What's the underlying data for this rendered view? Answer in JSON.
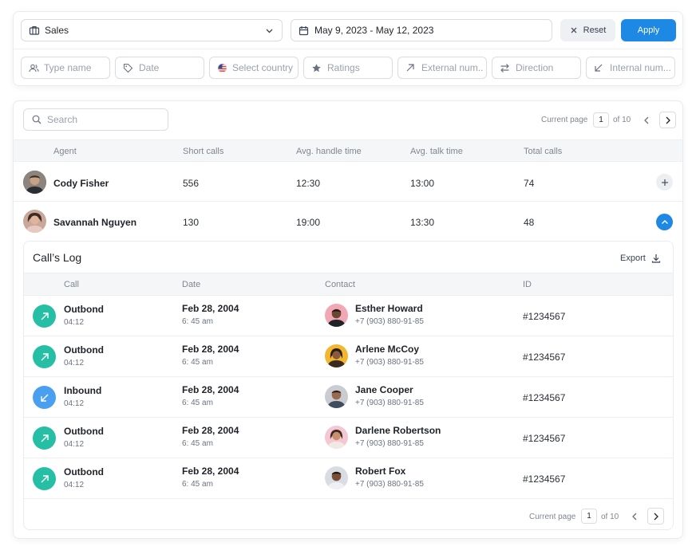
{
  "filters": {
    "department": {
      "value": "Sales",
      "icon": "briefcase-icon"
    },
    "date_range": {
      "value": "May 9, 2023 - May 12, 2023",
      "icon": "calendar-icon"
    },
    "reset_label": "Reset",
    "apply_label": "Apply",
    "fields": [
      {
        "placeholder": "Type name",
        "icon": "users-icon"
      },
      {
        "placeholder": "Date",
        "icon": "tag-icon"
      },
      {
        "placeholder": "Select country",
        "icon": "us-flag-icon"
      },
      {
        "placeholder": "Ratings",
        "icon": "star-icon"
      },
      {
        "placeholder": "External num..",
        "icon": "arrow-up-right-icon"
      },
      {
        "placeholder": "Direction",
        "icon": "swap-arrows-icon"
      },
      {
        "placeholder": "Internal num...",
        "icon": "arrow-down-left-icon"
      }
    ]
  },
  "table": {
    "search_placeholder": "Search",
    "pager": {
      "label": "Current page",
      "page": "1",
      "of": "of 10"
    },
    "columns": [
      "Agent",
      "Short calls",
      "Avg. handle time",
      "Avg. talk time",
      "Total calls"
    ],
    "agents": [
      {
        "name": "Cody Fisher",
        "short_calls": "556",
        "handle": "12:30",
        "talk": "13:00",
        "total": "74",
        "expanded": false
      },
      {
        "name": "Savannah Nguyen",
        "short_calls": "130",
        "handle": "19:00",
        "talk": "13:30",
        "total": "48",
        "expanded": true
      }
    ]
  },
  "calls_log": {
    "title": "Call’s Log",
    "export_label": "Export",
    "columns": [
      "Call",
      "Date",
      "Contact",
      "ID"
    ],
    "rows": [
      {
        "type": "Outbond",
        "duration": "04:12",
        "date": "Feb 28, 2004",
        "time": "6: 45 am",
        "name": "Esther Howard",
        "phone": "+7 (903) 880-91-85",
        "id": "#1234567",
        "direction": "out"
      },
      {
        "type": "Outbond",
        "duration": "04:12",
        "date": "Feb 28, 2004",
        "time": "6: 45 am",
        "name": "Arlene McCoy",
        "phone": "+7 (903) 880-91-85",
        "id": "#1234567",
        "direction": "out"
      },
      {
        "type": "Inbound",
        "duration": "04:12",
        "date": "Feb 28, 2004",
        "time": "6: 45 am",
        "name": "Jane Cooper",
        "phone": "+7 (903) 880-91-85",
        "id": "#1234567",
        "direction": "in"
      },
      {
        "type": "Outbond",
        "duration": "04:12",
        "date": "Feb 28, 2004",
        "time": "6: 45 am",
        "name": "Darlene Robertson",
        "phone": "+7 (903) 880-91-85",
        "id": "#1234567",
        "direction": "out"
      },
      {
        "type": "Outbond",
        "duration": "04:12",
        "date": "Feb 28, 2004",
        "time": "6: 45 am",
        "name": "Robert Fox",
        "phone": "+7 (903) 880-91-85",
        "id": "#1234567",
        "direction": "out"
      }
    ],
    "pager": {
      "label": "Current page",
      "page": "1",
      "of": "of 10"
    }
  },
  "colors": {
    "accent": "#1e88e5",
    "outbound": "#26bfa5",
    "inbound": "#4a9ff0"
  }
}
